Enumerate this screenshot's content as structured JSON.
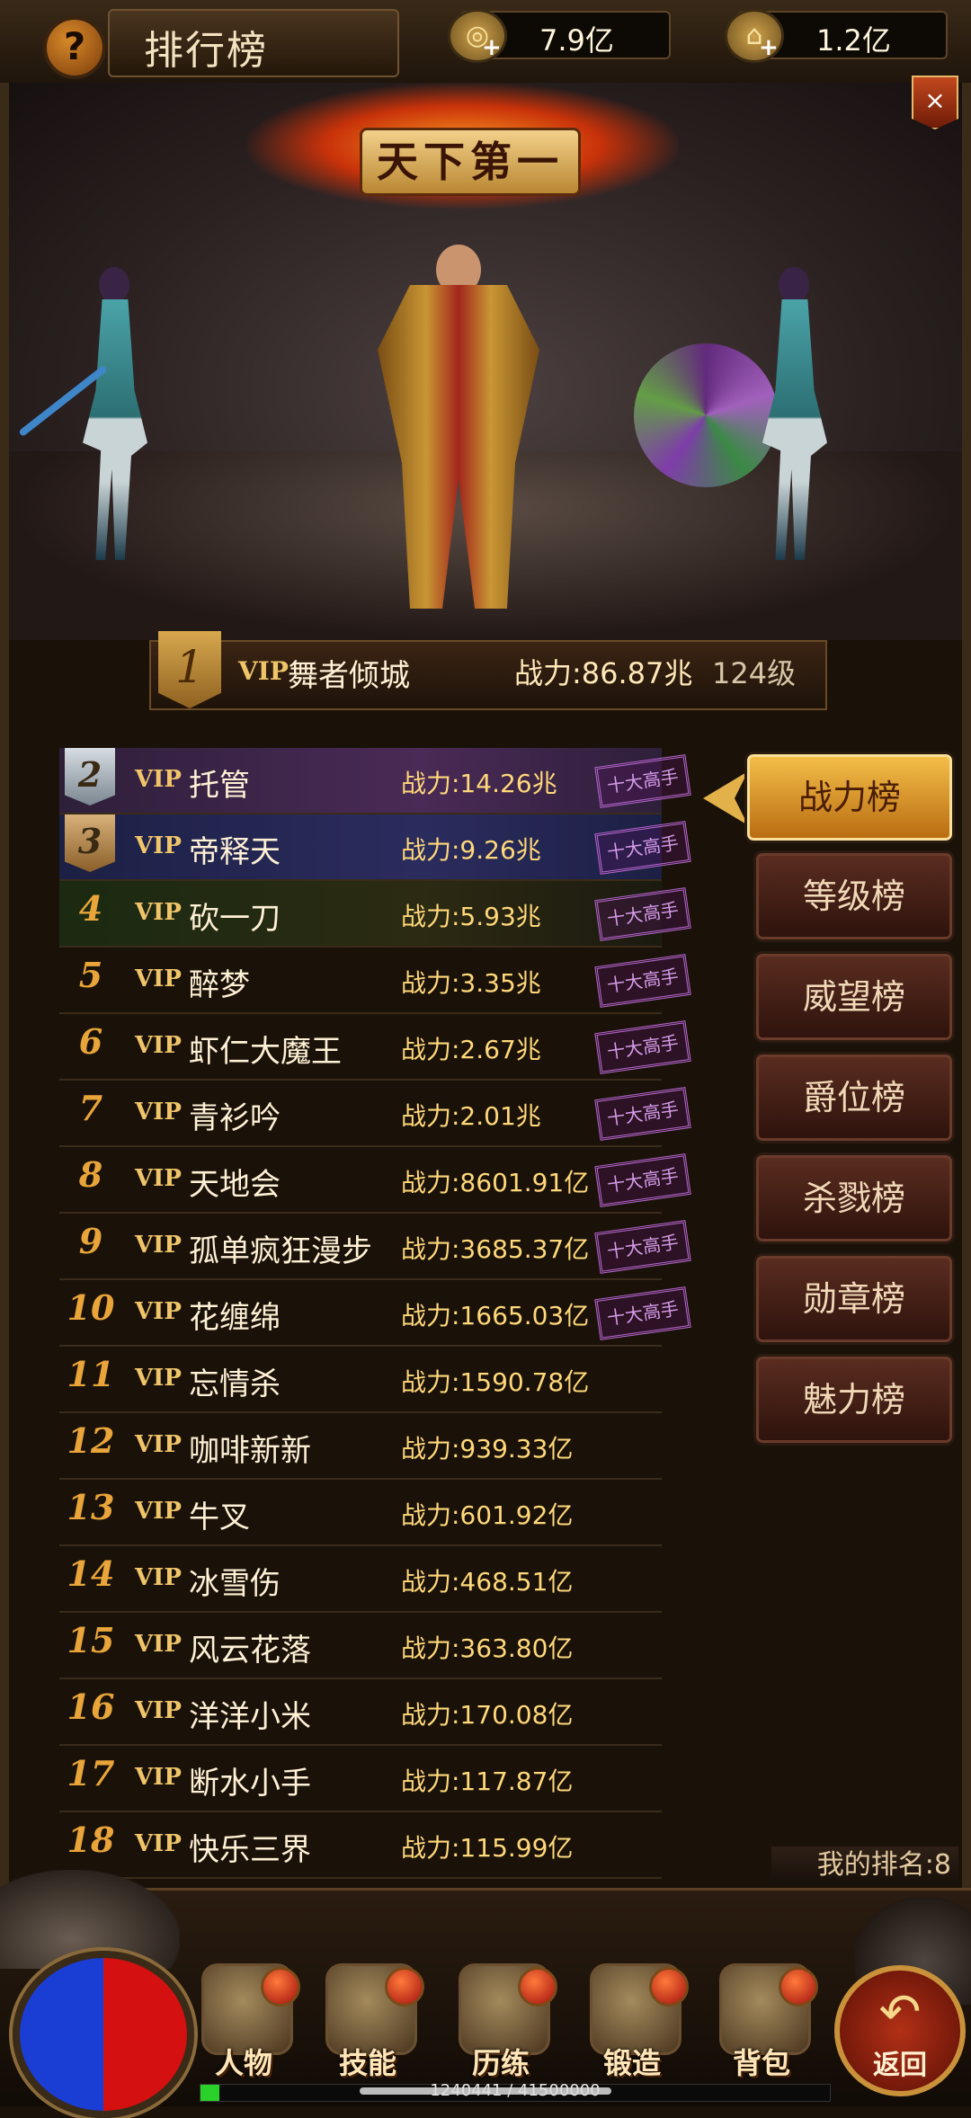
{
  "header": {
    "title": "排行榜",
    "help_icon": "question-mark",
    "currencies": [
      {
        "icon": "coins-icon",
        "value": "7.9亿"
      },
      {
        "icon": "gold-ingot-icon",
        "value": "1.2亿"
      }
    ],
    "close_label": "×"
  },
  "banner": {
    "text": "天下第一"
  },
  "champion": {
    "rank": "1",
    "vip": "VIP",
    "name": "舞者倾城",
    "power": "战力:86.87兆",
    "level": "124级"
  },
  "rankings": [
    {
      "rank": "2",
      "vip": "VIP",
      "name": "托管",
      "power": "战力:14.26兆",
      "tag": "十大高手"
    },
    {
      "rank": "3",
      "vip": "VIP",
      "name": "帝释天",
      "power": "战力:9.26兆",
      "tag": "十大高手"
    },
    {
      "rank": "4",
      "vip": "VIP",
      "name": "砍一刀",
      "power": "战力:5.93兆",
      "tag": "十大高手"
    },
    {
      "rank": "5",
      "vip": "VIP",
      "name": "醉梦",
      "power": "战力:3.35兆",
      "tag": "十大高手"
    },
    {
      "rank": "6",
      "vip": "VIP",
      "name": "虾仁大魔王",
      "power": "战力:2.67兆",
      "tag": "十大高手"
    },
    {
      "rank": "7",
      "vip": "VIP",
      "name": "青衫吟",
      "power": "战力:2.01兆",
      "tag": "十大高手"
    },
    {
      "rank": "8",
      "vip": "VIP",
      "name": "天地会",
      "power": "战力:8601.91亿",
      "tag": "十大高手"
    },
    {
      "rank": "9",
      "vip": "VIP",
      "name": "孤单疯狂漫步",
      "power": "战力:3685.37亿",
      "tag": "十大高手"
    },
    {
      "rank": "10",
      "vip": "VIP",
      "name": "花缠绵",
      "power": "战力:1665.03亿",
      "tag": "十大高手"
    },
    {
      "rank": "11",
      "vip": "VIP",
      "name": "忘情杀",
      "power": "战力:1590.78亿",
      "tag": ""
    },
    {
      "rank": "12",
      "vip": "VIP",
      "name": "咖啡新新",
      "power": "战力:939.33亿",
      "tag": ""
    },
    {
      "rank": "13",
      "vip": "VIP",
      "name": "牛叉",
      "power": "战力:601.92亿",
      "tag": ""
    },
    {
      "rank": "14",
      "vip": "VIP",
      "name": "冰雪伤",
      "power": "战力:468.51亿",
      "tag": ""
    },
    {
      "rank": "15",
      "vip": "VIP",
      "name": "风云花落",
      "power": "战力:363.80亿",
      "tag": ""
    },
    {
      "rank": "16",
      "vip": "VIP",
      "name": "洋洋小米",
      "power": "战力:170.08亿",
      "tag": ""
    },
    {
      "rank": "17",
      "vip": "VIP",
      "name": "断水小手",
      "power": "战力:117.87亿",
      "tag": ""
    },
    {
      "rank": "18",
      "vip": "VIP",
      "name": "快乐三界",
      "power": "战力:115.99亿",
      "tag": ""
    }
  ],
  "tabs": [
    {
      "label": "战力榜",
      "active": true
    },
    {
      "label": "等级榜",
      "active": false
    },
    {
      "label": "威望榜",
      "active": false
    },
    {
      "label": "爵位榜",
      "active": false
    },
    {
      "label": "杀戮榜",
      "active": false
    },
    {
      "label": "勋章榜",
      "active": false
    },
    {
      "label": "魅力榜",
      "active": false
    }
  ],
  "my_rank": "我的排名:8",
  "bottom_nav": [
    {
      "label": "人物",
      "icon": "character-icon"
    },
    {
      "label": "技能",
      "icon": "skill-book-icon"
    },
    {
      "label": "历练",
      "icon": "training-icon"
    },
    {
      "label": "锻造",
      "icon": "anvil-icon"
    },
    {
      "label": "背包",
      "icon": "backpack-icon"
    }
  ],
  "back_label": "返回",
  "exp": {
    "text": "1240441 / 41500000",
    "current": 1240441,
    "max": 41500000
  },
  "colors": {
    "accent_gold": "#e9a53a",
    "tag_purple": "#b86ad0",
    "exp_green": "#2bd12b"
  }
}
